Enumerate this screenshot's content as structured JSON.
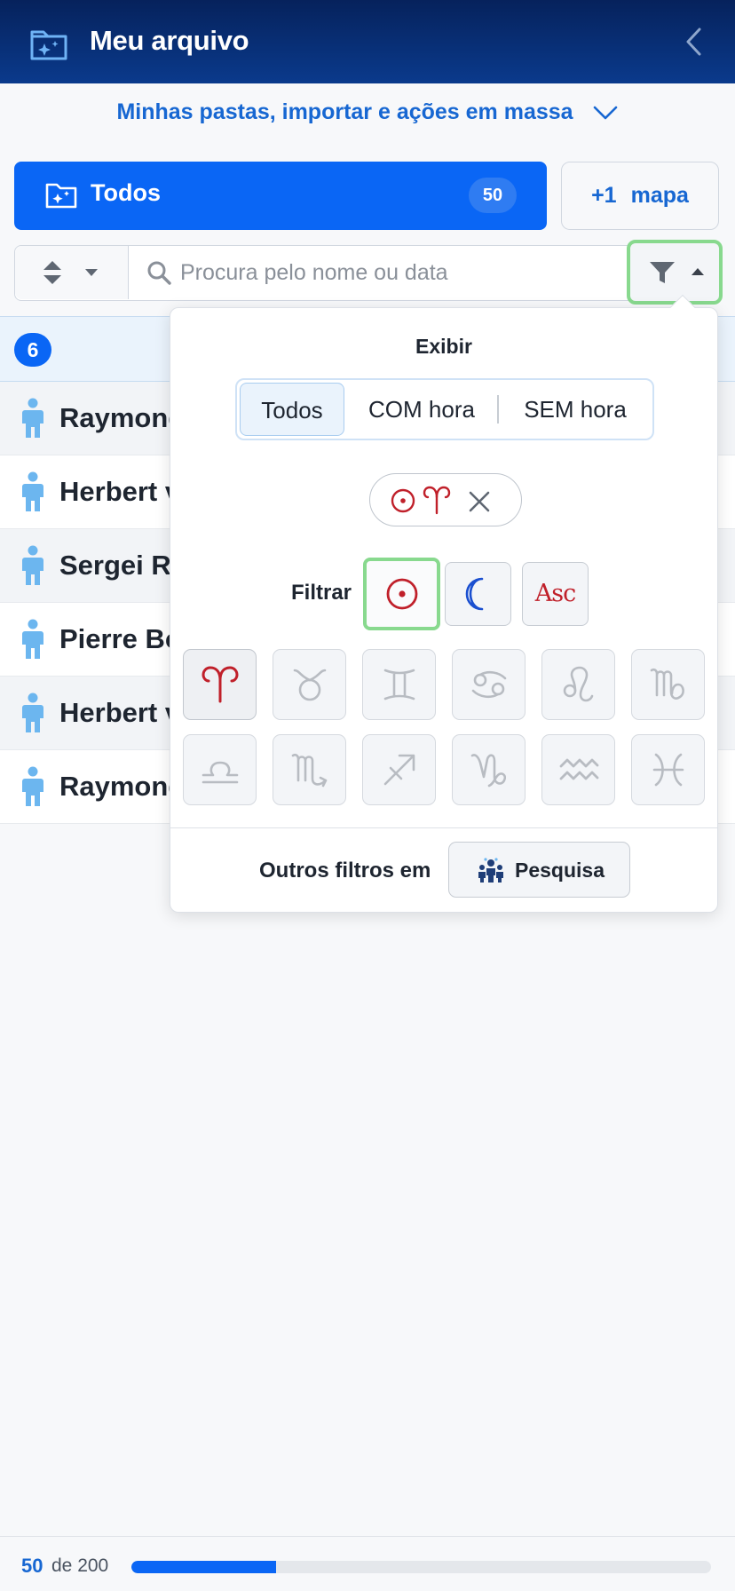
{
  "header": {
    "title": "Meu arquivo",
    "icons": {
      "app": "folder-sparkle-icon",
      "back": "chevron-left-icon"
    }
  },
  "folders": {
    "link_label": "Minhas pastas, importar e ações em massa",
    "icon": "chevron-down-icon"
  },
  "tabs": {
    "all": {
      "label": "Todos",
      "count": "50",
      "icon": "folder-sparkle-icon"
    },
    "add_map": {
      "plus": "+1",
      "label": "mapa"
    }
  },
  "search": {
    "placeholder": "Procura pelo nome ou data",
    "value": "",
    "icons": {
      "sort": "sort-updown-icon",
      "search": "search-icon",
      "filter": "funnel-icon"
    }
  },
  "list": {
    "count": "6",
    "items": [
      {
        "name": "Raymond"
      },
      {
        "name": "Herbert v"
      },
      {
        "name": "Sergei Ra"
      },
      {
        "name": "Pierre Bo"
      },
      {
        "name": "Herbert v"
      },
      {
        "name": "Raymond"
      }
    ]
  },
  "filter_popover": {
    "title": "Exibir",
    "display_options": [
      {
        "label": "Todos",
        "active": true
      },
      {
        "label": "COM hora",
        "active": false
      },
      {
        "label": "SEM hora",
        "active": false
      }
    ],
    "active_chip": {
      "planet": "sun",
      "sign": "aries",
      "remove_icon": "close-icon"
    },
    "filter_label": "Filtrar",
    "planet_options": [
      {
        "name": "sun",
        "selected": true
      },
      {
        "name": "moon",
        "selected": false
      },
      {
        "name": "ascendant",
        "label": "Asc",
        "selected": false
      }
    ],
    "signs": [
      {
        "name": "aries",
        "active": true
      },
      {
        "name": "taurus",
        "active": false
      },
      {
        "name": "gemini",
        "active": false
      },
      {
        "name": "cancer",
        "active": false
      },
      {
        "name": "leo",
        "active": false
      },
      {
        "name": "virgo",
        "active": false
      },
      {
        "name": "libra",
        "active": false
      },
      {
        "name": "scorpio",
        "active": false
      },
      {
        "name": "sagittarius",
        "active": false
      },
      {
        "name": "capricorn",
        "active": false
      },
      {
        "name": "aquarius",
        "active": false
      },
      {
        "name": "pisces",
        "active": false
      }
    ],
    "footer": {
      "label": "Outros filtros em",
      "button_label": "Pesquisa",
      "button_icon": "people-search-icon"
    }
  },
  "progress": {
    "shown": "50",
    "of_label": "de 200",
    "fraction": 0.25
  },
  "colors": {
    "header": "#06225c",
    "primary": "#0a66f5",
    "link": "#1767d2",
    "sign_active": "#c0202a",
    "moon": "#1a4fd0",
    "selected_outline": "#88d98e",
    "person_icon": "#6cb6ef"
  }
}
